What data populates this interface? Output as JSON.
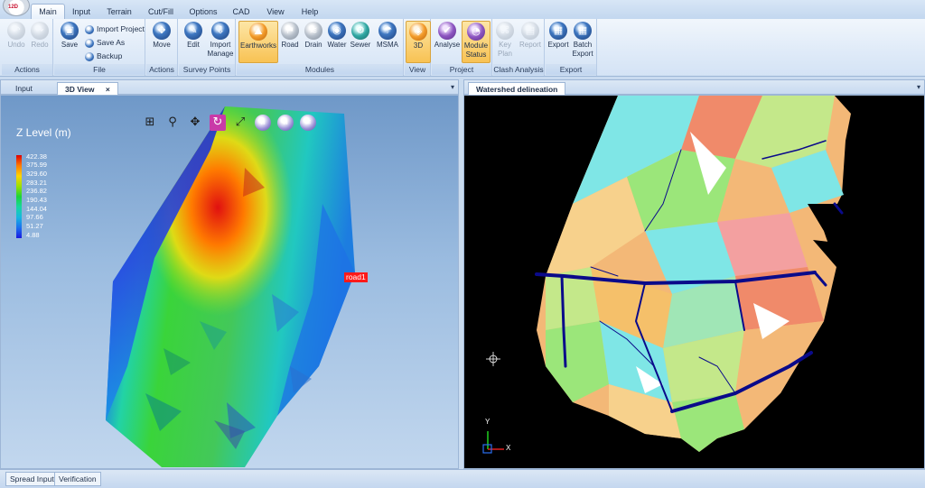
{
  "app": {
    "logo_text": "12D"
  },
  "ribbon_tabs": [
    "Main",
    "Input",
    "Terrain",
    "Cut/Fill",
    "Options",
    "CAD",
    "View",
    "Help"
  ],
  "groups": {
    "actions1": {
      "label": "Actions",
      "undo": "Undo",
      "redo": "Redo"
    },
    "file": {
      "label": "File",
      "save": "Save",
      "import_project": "Import Project",
      "save_as": "Save As",
      "backup": "Backup"
    },
    "actions2": {
      "label": "Actions",
      "move": "Move"
    },
    "survey": {
      "label": "Survey Points",
      "edit": "Edit",
      "import_line1": "Import",
      "import_line2": "Manage"
    },
    "modules": {
      "label": "Modules",
      "earthworks": "Earthworks",
      "road": "Road",
      "drain": "Drain",
      "water": "Water",
      "sewer": "Sewer",
      "msma": "MSMA"
    },
    "view": {
      "label": "View",
      "threed": "3D"
    },
    "project": {
      "label": "Project",
      "analyse": "Analyse",
      "module_line1": "Module",
      "module_line2": "Status"
    },
    "clash": {
      "label": "Clash Analysis",
      "key_line1": "Key",
      "key_line2": "Plan",
      "report": "Report"
    },
    "export": {
      "label": "Export",
      "export": "Export",
      "batch_line1": "Batch",
      "batch_line2": "Export"
    }
  },
  "left_pane": {
    "tabs": [
      "Input",
      "3D View"
    ],
    "close_glyph": "×",
    "menu_glyph": "▾",
    "legend": {
      "title": "Z Level (m)",
      "values": [
        "422.38",
        "375.99",
        "329.60",
        "283.21",
        "236.82",
        "190.43",
        "144.04",
        "97.66",
        "51.27",
        "4.88"
      ]
    },
    "road_label": "road1",
    "toolbar_icons": [
      "zoom-window-icon",
      "zoom-icon",
      "pan-icon",
      "rotate-icon",
      "fit-icon",
      "section-icon-1",
      "section-icon-2",
      "layer-icon"
    ]
  },
  "right_pane": {
    "tabs": [
      "Watershed delineation"
    ],
    "menu_glyph": "▾",
    "axis_y": "Y",
    "axis_x": "X"
  },
  "bottom_tabs": [
    "Spread Input",
    "Verification"
  ],
  "colors": {
    "ribbon_active": "#f8c253",
    "road_label": "#ff1a1a"
  }
}
